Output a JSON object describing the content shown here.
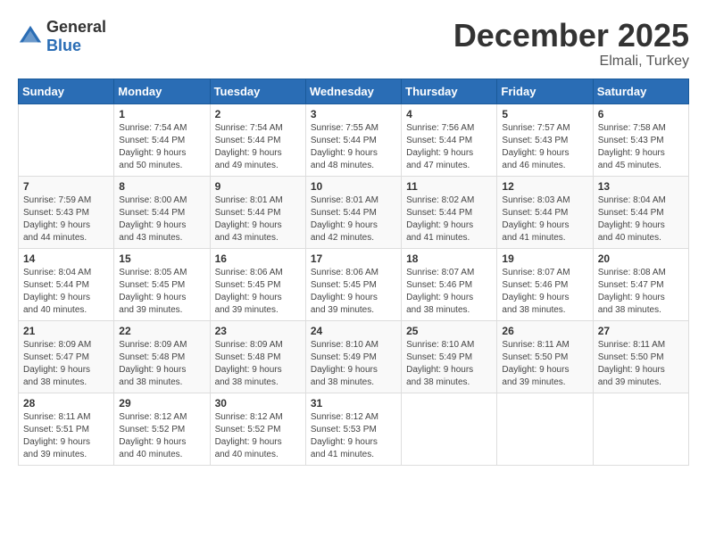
{
  "header": {
    "logo_general": "General",
    "logo_blue": "Blue",
    "month_title": "December 2025",
    "location": "Elmali, Turkey"
  },
  "days_of_week": [
    "Sunday",
    "Monday",
    "Tuesday",
    "Wednesday",
    "Thursday",
    "Friday",
    "Saturday"
  ],
  "weeks": [
    [
      {
        "day": "",
        "sunrise": "",
        "sunset": "",
        "daylight": ""
      },
      {
        "day": "1",
        "sunrise": "Sunrise: 7:54 AM",
        "sunset": "Sunset: 5:44 PM",
        "daylight": "Daylight: 9 hours and 50 minutes."
      },
      {
        "day": "2",
        "sunrise": "Sunrise: 7:54 AM",
        "sunset": "Sunset: 5:44 PM",
        "daylight": "Daylight: 9 hours and 49 minutes."
      },
      {
        "day": "3",
        "sunrise": "Sunrise: 7:55 AM",
        "sunset": "Sunset: 5:44 PM",
        "daylight": "Daylight: 9 hours and 48 minutes."
      },
      {
        "day": "4",
        "sunrise": "Sunrise: 7:56 AM",
        "sunset": "Sunset: 5:44 PM",
        "daylight": "Daylight: 9 hours and 47 minutes."
      },
      {
        "day": "5",
        "sunrise": "Sunrise: 7:57 AM",
        "sunset": "Sunset: 5:43 PM",
        "daylight": "Daylight: 9 hours and 46 minutes."
      },
      {
        "day": "6",
        "sunrise": "Sunrise: 7:58 AM",
        "sunset": "Sunset: 5:43 PM",
        "daylight": "Daylight: 9 hours and 45 minutes."
      }
    ],
    [
      {
        "day": "7",
        "sunrise": "Sunrise: 7:59 AM",
        "sunset": "Sunset: 5:43 PM",
        "daylight": "Daylight: 9 hours and 44 minutes."
      },
      {
        "day": "8",
        "sunrise": "Sunrise: 8:00 AM",
        "sunset": "Sunset: 5:44 PM",
        "daylight": "Daylight: 9 hours and 43 minutes."
      },
      {
        "day": "9",
        "sunrise": "Sunrise: 8:01 AM",
        "sunset": "Sunset: 5:44 PM",
        "daylight": "Daylight: 9 hours and 43 minutes."
      },
      {
        "day": "10",
        "sunrise": "Sunrise: 8:01 AM",
        "sunset": "Sunset: 5:44 PM",
        "daylight": "Daylight: 9 hours and 42 minutes."
      },
      {
        "day": "11",
        "sunrise": "Sunrise: 8:02 AM",
        "sunset": "Sunset: 5:44 PM",
        "daylight": "Daylight: 9 hours and 41 minutes."
      },
      {
        "day": "12",
        "sunrise": "Sunrise: 8:03 AM",
        "sunset": "Sunset: 5:44 PM",
        "daylight": "Daylight: 9 hours and 41 minutes."
      },
      {
        "day": "13",
        "sunrise": "Sunrise: 8:04 AM",
        "sunset": "Sunset: 5:44 PM",
        "daylight": "Daylight: 9 hours and 40 minutes."
      }
    ],
    [
      {
        "day": "14",
        "sunrise": "Sunrise: 8:04 AM",
        "sunset": "Sunset: 5:44 PM",
        "daylight": "Daylight: 9 hours and 40 minutes."
      },
      {
        "day": "15",
        "sunrise": "Sunrise: 8:05 AM",
        "sunset": "Sunset: 5:45 PM",
        "daylight": "Daylight: 9 hours and 39 minutes."
      },
      {
        "day": "16",
        "sunrise": "Sunrise: 8:06 AM",
        "sunset": "Sunset: 5:45 PM",
        "daylight": "Daylight: 9 hours and 39 minutes."
      },
      {
        "day": "17",
        "sunrise": "Sunrise: 8:06 AM",
        "sunset": "Sunset: 5:45 PM",
        "daylight": "Daylight: 9 hours and 39 minutes."
      },
      {
        "day": "18",
        "sunrise": "Sunrise: 8:07 AM",
        "sunset": "Sunset: 5:46 PM",
        "daylight": "Daylight: 9 hours and 38 minutes."
      },
      {
        "day": "19",
        "sunrise": "Sunrise: 8:07 AM",
        "sunset": "Sunset: 5:46 PM",
        "daylight": "Daylight: 9 hours and 38 minutes."
      },
      {
        "day": "20",
        "sunrise": "Sunrise: 8:08 AM",
        "sunset": "Sunset: 5:47 PM",
        "daylight": "Daylight: 9 hours and 38 minutes."
      }
    ],
    [
      {
        "day": "21",
        "sunrise": "Sunrise: 8:09 AM",
        "sunset": "Sunset: 5:47 PM",
        "daylight": "Daylight: 9 hours and 38 minutes."
      },
      {
        "day": "22",
        "sunrise": "Sunrise: 8:09 AM",
        "sunset": "Sunset: 5:48 PM",
        "daylight": "Daylight: 9 hours and 38 minutes."
      },
      {
        "day": "23",
        "sunrise": "Sunrise: 8:09 AM",
        "sunset": "Sunset: 5:48 PM",
        "daylight": "Daylight: 9 hours and 38 minutes."
      },
      {
        "day": "24",
        "sunrise": "Sunrise: 8:10 AM",
        "sunset": "Sunset: 5:49 PM",
        "daylight": "Daylight: 9 hours and 38 minutes."
      },
      {
        "day": "25",
        "sunrise": "Sunrise: 8:10 AM",
        "sunset": "Sunset: 5:49 PM",
        "daylight": "Daylight: 9 hours and 38 minutes."
      },
      {
        "day": "26",
        "sunrise": "Sunrise: 8:11 AM",
        "sunset": "Sunset: 5:50 PM",
        "daylight": "Daylight: 9 hours and 39 minutes."
      },
      {
        "day": "27",
        "sunrise": "Sunrise: 8:11 AM",
        "sunset": "Sunset: 5:50 PM",
        "daylight": "Daylight: 9 hours and 39 minutes."
      }
    ],
    [
      {
        "day": "28",
        "sunrise": "Sunrise: 8:11 AM",
        "sunset": "Sunset: 5:51 PM",
        "daylight": "Daylight: 9 hours and 39 minutes."
      },
      {
        "day": "29",
        "sunrise": "Sunrise: 8:12 AM",
        "sunset": "Sunset: 5:52 PM",
        "daylight": "Daylight: 9 hours and 40 minutes."
      },
      {
        "day": "30",
        "sunrise": "Sunrise: 8:12 AM",
        "sunset": "Sunset: 5:52 PM",
        "daylight": "Daylight: 9 hours and 40 minutes."
      },
      {
        "day": "31",
        "sunrise": "Sunrise: 8:12 AM",
        "sunset": "Sunset: 5:53 PM",
        "daylight": "Daylight: 9 hours and 41 minutes."
      },
      {
        "day": "",
        "sunrise": "",
        "sunset": "",
        "daylight": ""
      },
      {
        "day": "",
        "sunrise": "",
        "sunset": "",
        "daylight": ""
      },
      {
        "day": "",
        "sunrise": "",
        "sunset": "",
        "daylight": ""
      }
    ]
  ]
}
